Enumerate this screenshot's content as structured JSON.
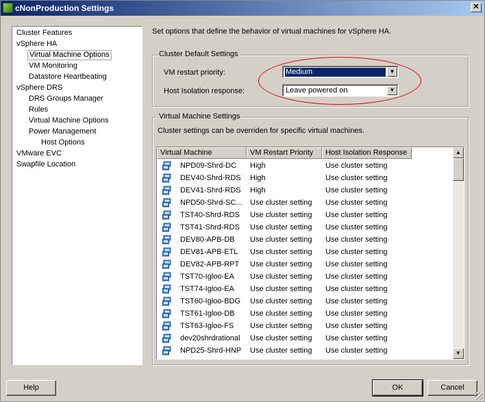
{
  "window": {
    "title": "cNonProduction Settings",
    "close_glyph": "✕"
  },
  "nav": {
    "items": [
      {
        "label": "Cluster Features",
        "indent": 0
      },
      {
        "label": "vSphere HA",
        "indent": 0
      },
      {
        "label": "Virtual Machine Options",
        "indent": 1,
        "selected": true
      },
      {
        "label": "VM Monitoring",
        "indent": 1
      },
      {
        "label": "Datastore Heartbeating",
        "indent": 1
      },
      {
        "label": "vSphere DRS",
        "indent": 0
      },
      {
        "label": "DRS Groups Manager",
        "indent": 1
      },
      {
        "label": "Rules",
        "indent": 1
      },
      {
        "label": "Virtual Machine Options",
        "indent": 1
      },
      {
        "label": "Power Management",
        "indent": 1
      },
      {
        "label": "Host Options",
        "indent": 2
      },
      {
        "label": "VMware EVC",
        "indent": 0
      },
      {
        "label": "Swapfile Location",
        "indent": 0
      }
    ]
  },
  "main": {
    "description": "Set options that define the behavior of virtual machines for vSphere HA.",
    "cluster_defaults": {
      "title": "Cluster Default Settings",
      "restart_label": "VM restart priority:",
      "restart_value": "Medium",
      "isolation_label": "Host Isolation response:",
      "isolation_value": "Leave powered on"
    },
    "vm_settings": {
      "title": "Virtual Machine Settings",
      "description": "Cluster settings can be overriden for specific virtual machines.",
      "columns": [
        "Virtual Machine",
        "VM Restart Priority",
        "Host Isolation Response"
      ],
      "rows": [
        [
          "NPD09-Shrd-DC",
          "High",
          "Use cluster setting"
        ],
        [
          "DEV40-Shrd-RDS",
          "High",
          "Use cluster setting"
        ],
        [
          "DEV41-Shrd-RDS",
          "High",
          "Use cluster setting"
        ],
        [
          "NPD50-Shrd-SC...",
          "Use cluster setting",
          "Use cluster setting"
        ],
        [
          "TST40-Shrd-RDS",
          "Use cluster setting",
          "Use cluster setting"
        ],
        [
          "TST41-Shrd-RDS",
          "Use cluster setting",
          "Use cluster setting"
        ],
        [
          "DEV80-APB-DB",
          "Use cluster setting",
          "Use cluster setting"
        ],
        [
          "DEV81-APB-ETL",
          "Use cluster setting",
          "Use cluster setting"
        ],
        [
          "DEV82-APB-RPT",
          "Use cluster setting",
          "Use cluster setting"
        ],
        [
          "TST70-Igloo-EA",
          "Use cluster setting",
          "Use cluster setting"
        ],
        [
          "TST74-Igloo-EA",
          "Use cluster setting",
          "Use cluster setting"
        ],
        [
          "TST60-Igloo-BDG",
          "Use cluster setting",
          "Use cluster setting"
        ],
        [
          "TST61-Igloo-DB",
          "Use cluster setting",
          "Use cluster setting"
        ],
        [
          "TST63-Igloo-FS",
          "Use cluster setting",
          "Use cluster setting"
        ],
        [
          "dev20shrdrational",
          "Use cluster setting",
          "Use cluster setting"
        ],
        [
          "NPD25-Shrd-HNP",
          "Use cluster setting",
          "Use cluster setting"
        ]
      ]
    }
  },
  "footer": {
    "help": "Help",
    "ok": "OK",
    "cancel": "Cancel"
  },
  "colors": {
    "titlebar_start": "#0a246a",
    "annotation_oval": "#e00000",
    "selection": "#0a246a"
  }
}
